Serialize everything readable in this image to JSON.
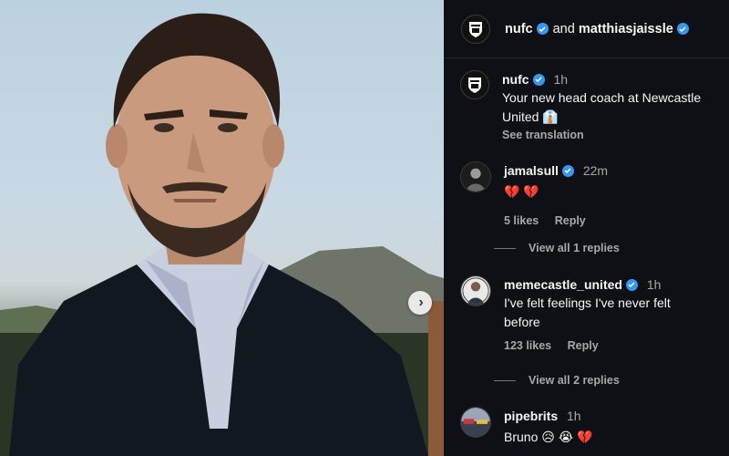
{
  "post": {
    "header": {
      "author": "nufc",
      "joiner": "and",
      "coauthor": "matthiasjaissle"
    },
    "caption": {
      "user": "nufc",
      "time": "1h",
      "text": "Your new head coach at Newcastle United 👔",
      "see_translation": "See translation"
    }
  },
  "comments": [
    {
      "user": "jamalsull",
      "time": "22m",
      "text": "💔 💔",
      "likes": "5 likes",
      "reply": "Reply",
      "view_replies": "View all 1 replies"
    },
    {
      "user": "memecastle_united",
      "time": "1h",
      "text": "I've felt feelings I've never felt before",
      "likes": "123 likes",
      "reply": "Reply",
      "view_replies": "View all 2 replies"
    },
    {
      "user": "pipebrits",
      "time": "1h",
      "text": "Bruno 😥 😭 💔"
    }
  ],
  "colors": {
    "panel_bg": "#0f1015",
    "verified": "#3797f0",
    "muted_text": "#a8a8a8"
  },
  "icons": {
    "verified": "verified-badge-icon",
    "next": "chevron-right-icon",
    "crest": "newcastle-crest-icon"
  }
}
